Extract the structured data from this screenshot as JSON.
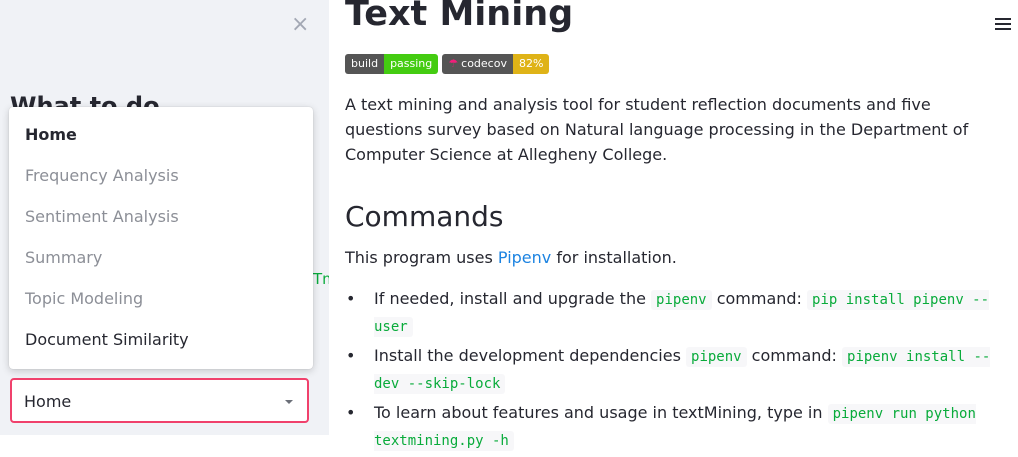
{
  "sidebar": {
    "close_glyph": "×",
    "heading": "What to do",
    "partial_text": "Tm",
    "dropdown_options": [
      "Home",
      "Frequency Analysis",
      "Sentiment Analysis",
      "Summary",
      "Topic Modeling",
      "Document Similarity"
    ],
    "selected_value": "Home"
  },
  "header": {
    "title": "Text Mining"
  },
  "badges": {
    "build_label": "build",
    "build_status": "passing",
    "codecov_label": "codecov",
    "codecov_value": "82%",
    "build_color": "#4c1",
    "codecov_color": "#dfb317"
  },
  "content": {
    "description": "A text mining and analysis tool for student reflection documents and five questions survey based on Natural language processing in the Department of Computer Science at Allegheny College.",
    "commands_heading": "Commands",
    "install_prefix": "This program uses ",
    "install_link": "Pipenv",
    "install_suffix": " for installation.",
    "bullets": [
      {
        "text1": "If needed, install and upgrade the ",
        "code1": "pipenv",
        "text2": " command: ",
        "code2": "pip install pipenv --user"
      },
      {
        "text1": "Install the development dependencies ",
        "code1": "pipenv",
        "text2": " command: ",
        "code2": "pipenv install --dev --skip-lock"
      },
      {
        "text1": "To learn about features and usage in textMining, type in ",
        "code1": "pipenv run python textmining.py -h"
      }
    ]
  },
  "colors": {
    "accent": "#f0416c",
    "link": "#1c83e1",
    "code": "#09ab3b"
  }
}
